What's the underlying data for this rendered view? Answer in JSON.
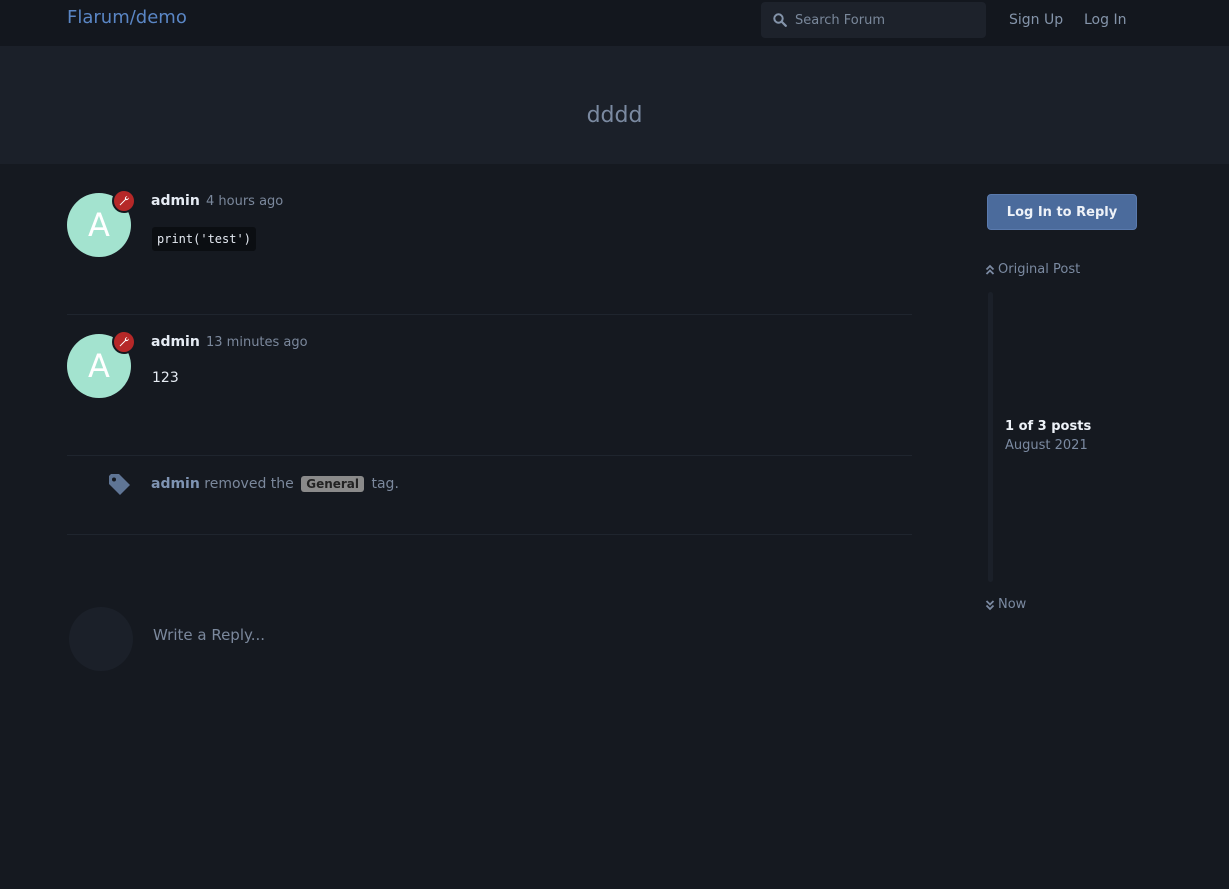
{
  "header": {
    "brand": "Flarum/demo",
    "search_placeholder": "Search Forum",
    "signup": "Sign Up",
    "login": "Log In"
  },
  "discussion": {
    "title": "dddd"
  },
  "posts": [
    {
      "user": "admin",
      "avatar_letter": "A",
      "time": "4 hours ago",
      "code": "print('test')"
    },
    {
      "user": "admin",
      "avatar_letter": "A",
      "time": "13 minutes ago",
      "body": "123"
    }
  ],
  "event": {
    "user": "admin",
    "action": "removed the",
    "tag": "General",
    "suffix": "tag."
  },
  "reply": {
    "placeholder": "Write a Reply..."
  },
  "sidebar": {
    "reply_button": "Log In to Reply",
    "original_post": "Original Post",
    "position": "1 of 3 posts",
    "date": "August 2021",
    "now": "Now"
  },
  "colors": {
    "background": "#151920",
    "accent": "#4b6b9c",
    "avatar": "#a3e3cf",
    "admin_badge": "#b62828"
  }
}
